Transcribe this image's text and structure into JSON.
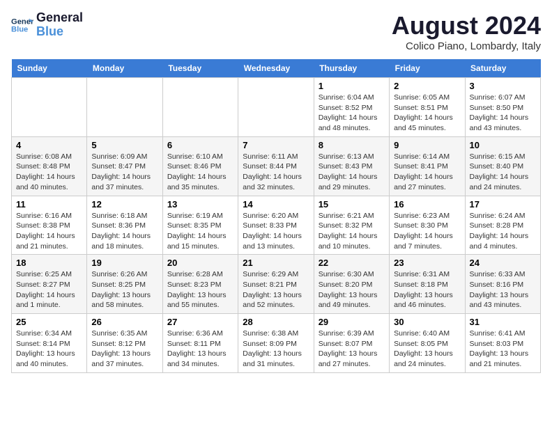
{
  "header": {
    "logo_line1": "General",
    "logo_line2": "Blue",
    "month_title": "August 2024",
    "subtitle": "Colico Piano, Lombardy, Italy"
  },
  "weekdays": [
    "Sunday",
    "Monday",
    "Tuesday",
    "Wednesday",
    "Thursday",
    "Friday",
    "Saturday"
  ],
  "weeks": [
    [
      {
        "day": "",
        "info": ""
      },
      {
        "day": "",
        "info": ""
      },
      {
        "day": "",
        "info": ""
      },
      {
        "day": "",
        "info": ""
      },
      {
        "day": "1",
        "info": "Sunrise: 6:04 AM\nSunset: 8:52 PM\nDaylight: 14 hours\nand 48 minutes."
      },
      {
        "day": "2",
        "info": "Sunrise: 6:05 AM\nSunset: 8:51 PM\nDaylight: 14 hours\nand 45 minutes."
      },
      {
        "day": "3",
        "info": "Sunrise: 6:07 AM\nSunset: 8:50 PM\nDaylight: 14 hours\nand 43 minutes."
      }
    ],
    [
      {
        "day": "4",
        "info": "Sunrise: 6:08 AM\nSunset: 8:48 PM\nDaylight: 14 hours\nand 40 minutes."
      },
      {
        "day": "5",
        "info": "Sunrise: 6:09 AM\nSunset: 8:47 PM\nDaylight: 14 hours\nand 37 minutes."
      },
      {
        "day": "6",
        "info": "Sunrise: 6:10 AM\nSunset: 8:46 PM\nDaylight: 14 hours\nand 35 minutes."
      },
      {
        "day": "7",
        "info": "Sunrise: 6:11 AM\nSunset: 8:44 PM\nDaylight: 14 hours\nand 32 minutes."
      },
      {
        "day": "8",
        "info": "Sunrise: 6:13 AM\nSunset: 8:43 PM\nDaylight: 14 hours\nand 29 minutes."
      },
      {
        "day": "9",
        "info": "Sunrise: 6:14 AM\nSunset: 8:41 PM\nDaylight: 14 hours\nand 27 minutes."
      },
      {
        "day": "10",
        "info": "Sunrise: 6:15 AM\nSunset: 8:40 PM\nDaylight: 14 hours\nand 24 minutes."
      }
    ],
    [
      {
        "day": "11",
        "info": "Sunrise: 6:16 AM\nSunset: 8:38 PM\nDaylight: 14 hours\nand 21 minutes."
      },
      {
        "day": "12",
        "info": "Sunrise: 6:18 AM\nSunset: 8:36 PM\nDaylight: 14 hours\nand 18 minutes."
      },
      {
        "day": "13",
        "info": "Sunrise: 6:19 AM\nSunset: 8:35 PM\nDaylight: 14 hours\nand 15 minutes."
      },
      {
        "day": "14",
        "info": "Sunrise: 6:20 AM\nSunset: 8:33 PM\nDaylight: 14 hours\nand 13 minutes."
      },
      {
        "day": "15",
        "info": "Sunrise: 6:21 AM\nSunset: 8:32 PM\nDaylight: 14 hours\nand 10 minutes."
      },
      {
        "day": "16",
        "info": "Sunrise: 6:23 AM\nSunset: 8:30 PM\nDaylight: 14 hours\nand 7 minutes."
      },
      {
        "day": "17",
        "info": "Sunrise: 6:24 AM\nSunset: 8:28 PM\nDaylight: 14 hours\nand 4 minutes."
      }
    ],
    [
      {
        "day": "18",
        "info": "Sunrise: 6:25 AM\nSunset: 8:27 PM\nDaylight: 14 hours\nand 1 minute."
      },
      {
        "day": "19",
        "info": "Sunrise: 6:26 AM\nSunset: 8:25 PM\nDaylight: 13 hours\nand 58 minutes."
      },
      {
        "day": "20",
        "info": "Sunrise: 6:28 AM\nSunset: 8:23 PM\nDaylight: 13 hours\nand 55 minutes."
      },
      {
        "day": "21",
        "info": "Sunrise: 6:29 AM\nSunset: 8:21 PM\nDaylight: 13 hours\nand 52 minutes."
      },
      {
        "day": "22",
        "info": "Sunrise: 6:30 AM\nSunset: 8:20 PM\nDaylight: 13 hours\nand 49 minutes."
      },
      {
        "day": "23",
        "info": "Sunrise: 6:31 AM\nSunset: 8:18 PM\nDaylight: 13 hours\nand 46 minutes."
      },
      {
        "day": "24",
        "info": "Sunrise: 6:33 AM\nSunset: 8:16 PM\nDaylight: 13 hours\nand 43 minutes."
      }
    ],
    [
      {
        "day": "25",
        "info": "Sunrise: 6:34 AM\nSunset: 8:14 PM\nDaylight: 13 hours\nand 40 minutes."
      },
      {
        "day": "26",
        "info": "Sunrise: 6:35 AM\nSunset: 8:12 PM\nDaylight: 13 hours\nand 37 minutes."
      },
      {
        "day": "27",
        "info": "Sunrise: 6:36 AM\nSunset: 8:11 PM\nDaylight: 13 hours\nand 34 minutes."
      },
      {
        "day": "28",
        "info": "Sunrise: 6:38 AM\nSunset: 8:09 PM\nDaylight: 13 hours\nand 31 minutes."
      },
      {
        "day": "29",
        "info": "Sunrise: 6:39 AM\nSunset: 8:07 PM\nDaylight: 13 hours\nand 27 minutes."
      },
      {
        "day": "30",
        "info": "Sunrise: 6:40 AM\nSunset: 8:05 PM\nDaylight: 13 hours\nand 24 minutes."
      },
      {
        "day": "31",
        "info": "Sunrise: 6:41 AM\nSunset: 8:03 PM\nDaylight: 13 hours\nand 21 minutes."
      }
    ]
  ]
}
